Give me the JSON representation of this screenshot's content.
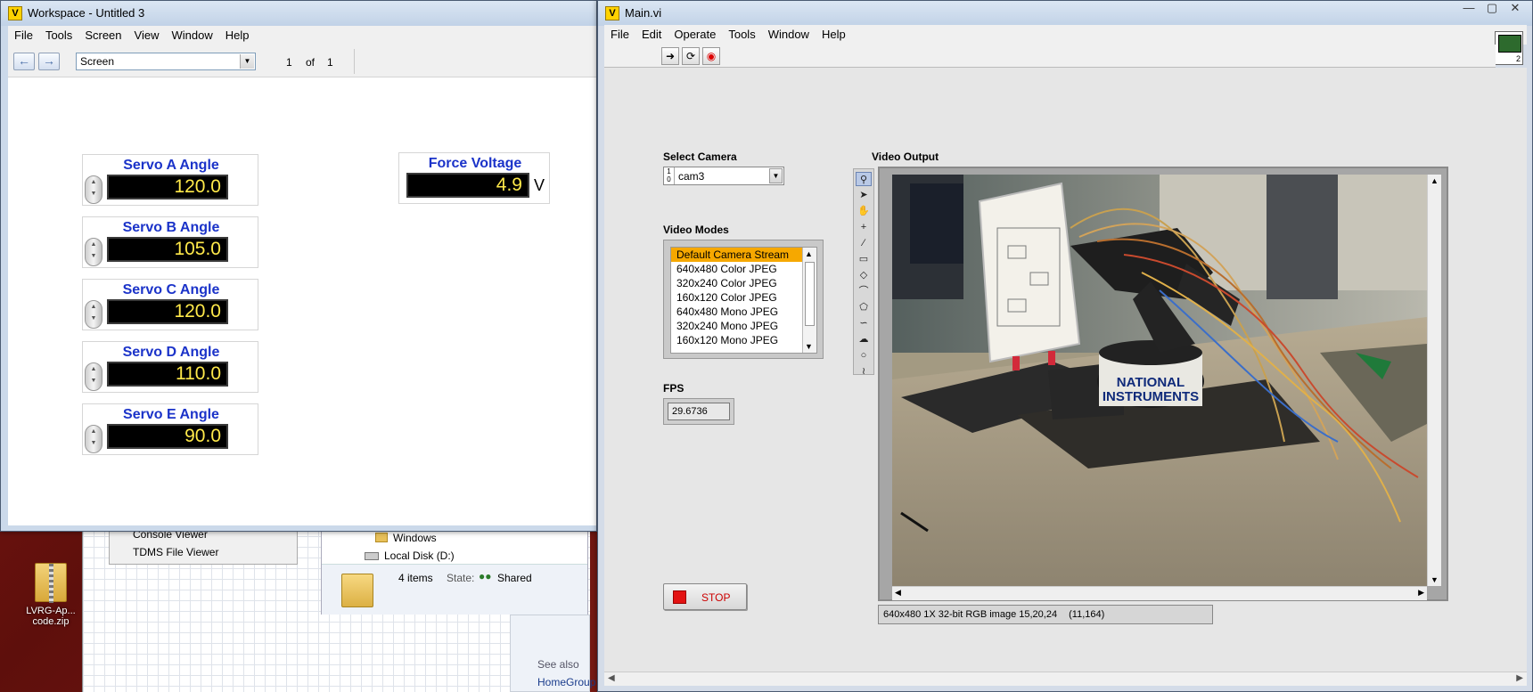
{
  "desktop": {
    "zip_label": "LVRG-Ap... code.zip"
  },
  "background": {
    "menu_items": [
      "Console Viewer",
      "TDMS File Viewer"
    ],
    "explorer": {
      "folder1": "Windows",
      "drive": "Local Disk (D:)",
      "items": "4 items",
      "state_label": "State:",
      "state_value": "Shared",
      "see_also": "See also",
      "homegroup": "HomeGroup"
    }
  },
  "workspace": {
    "title": "Workspace - Untitled 3",
    "menu": [
      "File",
      "Tools",
      "Screen",
      "View",
      "Window",
      "Help"
    ],
    "screen_select": "Screen",
    "page_current": "1",
    "page_of": "of",
    "page_total": "1",
    "controls": [
      {
        "label": "Servo A Angle",
        "value": "120.0"
      },
      {
        "label": "Servo B Angle",
        "value": "105.0"
      },
      {
        "label": "Servo C Angle",
        "value": "120.0"
      },
      {
        "label": "Servo D Angle",
        "value": "110.0"
      },
      {
        "label": "Servo E Angle",
        "value": "90.0"
      }
    ],
    "force": {
      "label": "Force Voltage",
      "value": "4.9",
      "unit": "V"
    }
  },
  "main_vi": {
    "title": "Main.vi",
    "menu": [
      "File",
      "Edit",
      "Operate",
      "Tools",
      "Window",
      "Help"
    ],
    "vi_icon_number": "2",
    "select_camera_label": "Select Camera",
    "camera_value": "cam3",
    "video_modes_label": "Video Modes",
    "video_modes": [
      "Default Camera Stream",
      "640x480 Color JPEG",
      "320x240 Color JPEG",
      "160x120 Color JPEG",
      "640x480 Mono JPEG",
      "320x240 Mono JPEG",
      "160x120 Mono JPEG"
    ],
    "selected_mode_index": 0,
    "fps_label": "FPS",
    "fps_value": "29.6736",
    "stop_label": "STOP",
    "video_output_label": "Video Output",
    "image_info": "640x480 1X 32-bit RGB image 15,20,24",
    "cursor_info": "(11,164)",
    "image_logo_text": [
      "NATIONAL",
      "INSTRUMENTS"
    ]
  }
}
